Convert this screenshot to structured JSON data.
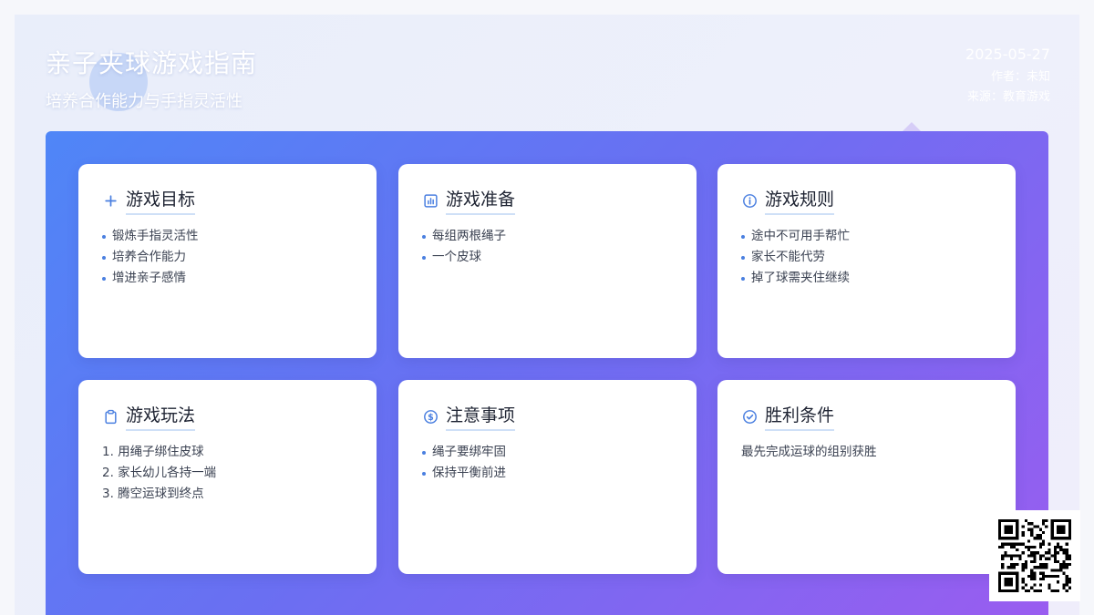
{
  "header": {
    "title": "亲子夹球游戏指南",
    "subtitle": "培养合作能力与手指灵活性",
    "date": "2025-05-27",
    "author": "作者：未知",
    "source": "来源：教育游戏"
  },
  "cards": [
    {
      "icon": "plus-icon",
      "title": "游戏目标",
      "items": [
        "锻炼手指灵活性",
        "培养合作能力",
        "增进亲子感情"
      ]
    },
    {
      "icon": "bar-chart-icon",
      "title": "游戏准备",
      "items": [
        "每组两根绳子",
        "一个皮球"
      ]
    },
    {
      "icon": "info-icon",
      "title": "游戏规则",
      "items": [
        "途中不可用手帮忙",
        "家长不能代劳",
        "掉了球需夹住继续"
      ]
    },
    {
      "icon": "clipboard-icon",
      "title": "游戏玩法",
      "items": [
        "1. 用绳子绑住皮球",
        "2. 家长幼儿各持一端",
        "3. 腾空运球到终点"
      ]
    },
    {
      "icon": "dollar-circle-icon",
      "title": "注意事项",
      "items": [
        "绳子要绑牢固",
        "保持平衡前进"
      ]
    },
    {
      "icon": "check-circle-icon",
      "title": "胜利条件",
      "text": "最先完成运球的组别获胜"
    }
  ],
  "colors": {
    "accent": "#4a7fe0",
    "panel_start": "#4f86f7",
    "panel_end": "#9b5cf0"
  }
}
